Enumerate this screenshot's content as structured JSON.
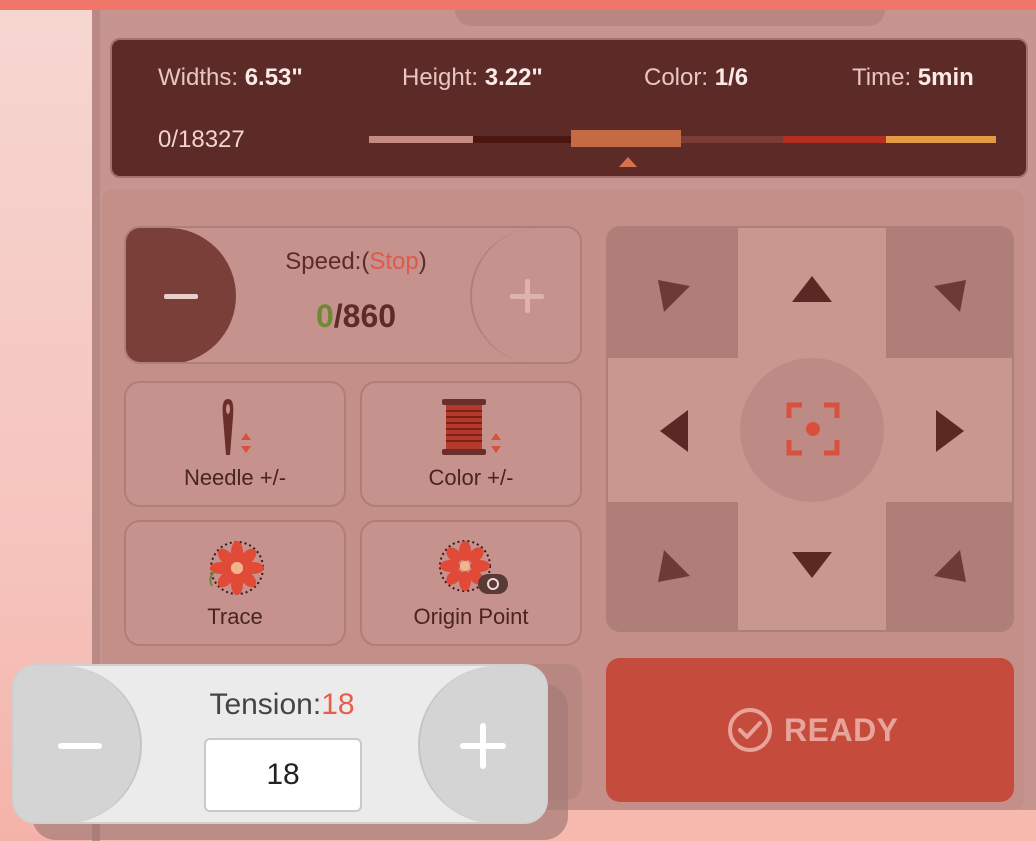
{
  "info": {
    "width_label": "Widths: ",
    "width_value": "6.53\"",
    "height_label": "Height: ",
    "height_value": "3.22\"",
    "color_label": "Color: ",
    "color_value": "1/6",
    "time_label": "Time: ",
    "time_value": "5min",
    "stitch_count": "0/18327",
    "color_segments": [
      "#c58a82",
      "#4a160f",
      "#c46a45",
      "#7a3c36",
      "#b42e22",
      "#e29a44"
    ],
    "current_segment": 3
  },
  "speed": {
    "label_prefix": "Speed:(",
    "status": "Stop",
    "label_suffix": ")",
    "current": "0",
    "max": "/860"
  },
  "buttons": {
    "needle": "Needle +/-",
    "color": "Color +/-",
    "trace": "Trace",
    "origin": "Origin Point"
  },
  "dpad": {
    "icons": [
      "arrow-up-left-icon",
      "arrow-up-icon",
      "arrow-up-right-icon",
      "arrow-left-icon",
      "center-target-icon",
      "arrow-right-icon",
      "arrow-down-left-icon",
      "arrow-down-icon",
      "arrow-down-right-icon"
    ]
  },
  "ready": {
    "label": "READY"
  },
  "tension": {
    "label": "Tension:",
    "value_display": "18",
    "input_value": "18"
  },
  "colors": {
    "accent": "#c54c3c",
    "info_bg": "#5d2b27",
    "panel_bg": "#c48f89",
    "stop_red": "#df5a48",
    "speed_green": "#6f8a34"
  }
}
